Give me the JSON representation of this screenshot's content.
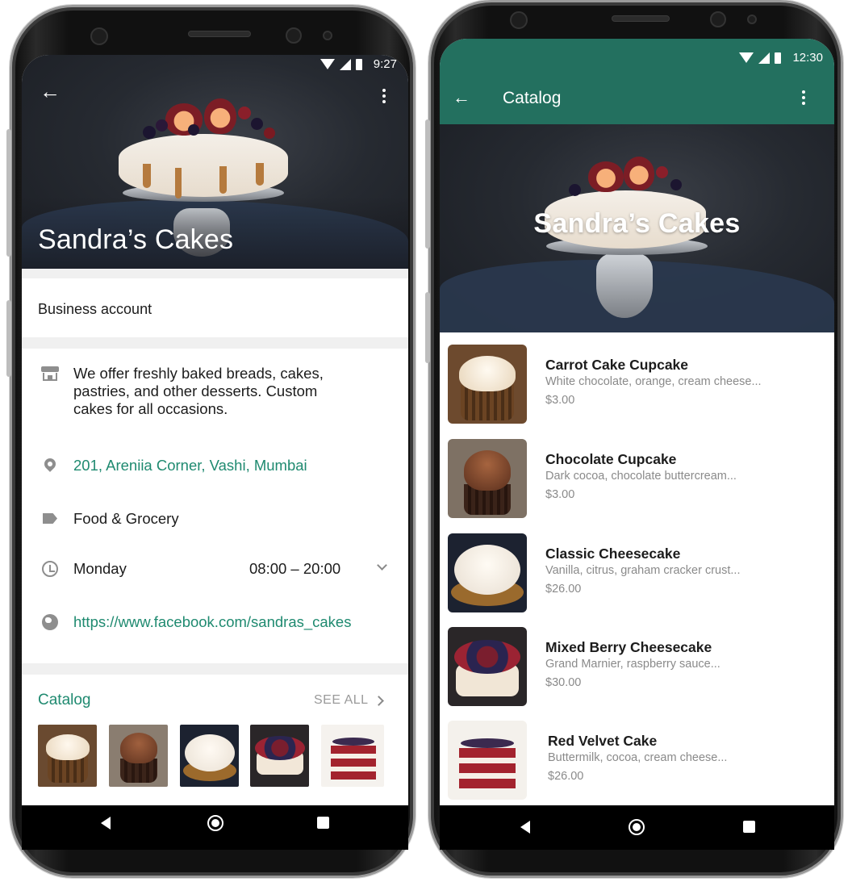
{
  "left_phone": {
    "status": {
      "time": "9:27"
    },
    "hero": {
      "title": "Sandra’s Cakes"
    },
    "business_account_label": "Business account",
    "description": "We offer freshly baked breads, cakes, pastries, and other desserts. Custom cakes for all occasions.",
    "address": "201, Areniia Corner, Vashi, Mumbai",
    "category": "Food & Grocery",
    "hours": {
      "day": "Monday",
      "time": "08:00 – 20:00"
    },
    "website": "https://www.facebook.com/sandras_cakes",
    "catalog": {
      "label": "Catalog",
      "see_all": "SEE ALL"
    },
    "accent_color": "#1f8a70"
  },
  "right_phone": {
    "status": {
      "time": "12:30"
    },
    "appbar": {
      "title": "Catalog",
      "color": "#23705f"
    },
    "hero": {
      "title": "Sandra’s Cakes"
    },
    "products": [
      {
        "name": "Carrot Cake Cupcake",
        "description": "White chocolate, orange, cream cheese...",
        "price": "$3.00"
      },
      {
        "name": "Chocolate Cupcake",
        "description": "Dark cocoa, chocolate buttercream...",
        "price": "$3.00"
      },
      {
        "name": "Classic Cheesecake",
        "description": "Vanilla, citrus, graham cracker crust...",
        "price": "$26.00"
      },
      {
        "name": "Mixed Berry Cheesecake",
        "description": "Grand Marnier, raspberry sauce...",
        "price": "$30.00"
      },
      {
        "name": "Red Velvet Cake",
        "description": "Buttermilk, cocoa, cream cheese...",
        "price": "$26.00"
      }
    ]
  }
}
